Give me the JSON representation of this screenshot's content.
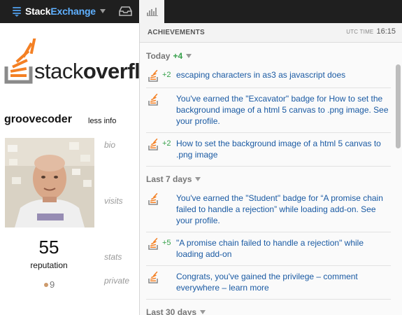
{
  "topbar": {
    "brand_stack": "Stack",
    "brand_exchange": "Exchange"
  },
  "profile": {
    "logo_light": "stack",
    "logo_bold": "overfl",
    "username": "groovecoder",
    "less_info": "less info",
    "labels": {
      "bio": "bio",
      "visits": "visits",
      "stats": "stats",
      "private": "private"
    },
    "reputation": "55",
    "reputation_label": "reputation",
    "bronze_badges": "9"
  },
  "achievements": {
    "title": "ACHIEVEMENTS",
    "utc_label": "UTC TIME",
    "utc_time": "16:15",
    "sections": {
      "today": {
        "label": "Today",
        "delta": "+4"
      },
      "last7": {
        "label": "Last 7 days"
      },
      "last30": {
        "label": "Last 30 days"
      }
    },
    "items": [
      {
        "delta": "+2",
        "text": "escaping characters in as3 as javascript does"
      },
      {
        "delta": "",
        "text": "You've earned the \"Excavator\" badge for How to set the background image of a html 5 canvas to .png image. See your profile."
      },
      {
        "delta": "+2",
        "text": "How to set the background image of a html 5 canvas to .png image"
      },
      {
        "delta": "",
        "text": "You've earned the \"Student\" badge for “A promise chain failed to handle a rejection” while loading add-on. See your profile."
      },
      {
        "delta": "+5",
        "text": "\"A promise chain failed to handle a rejection\" while loading add-on"
      },
      {
        "delta": "",
        "text": "Congrats, you've gained the privilege – comment everywhere – learn more"
      }
    ]
  },
  "colors": {
    "topbar_bg": "#1f1f1f",
    "link_blue": "#1a5aa3",
    "positive_green": "#35a04a",
    "so_orange": "#f48024"
  },
  "icons": {
    "brand": "stackexchange-icon",
    "inbox": "inbox-icon",
    "achievements": "achievements-icon",
    "item": "stackoverflow-icon"
  }
}
